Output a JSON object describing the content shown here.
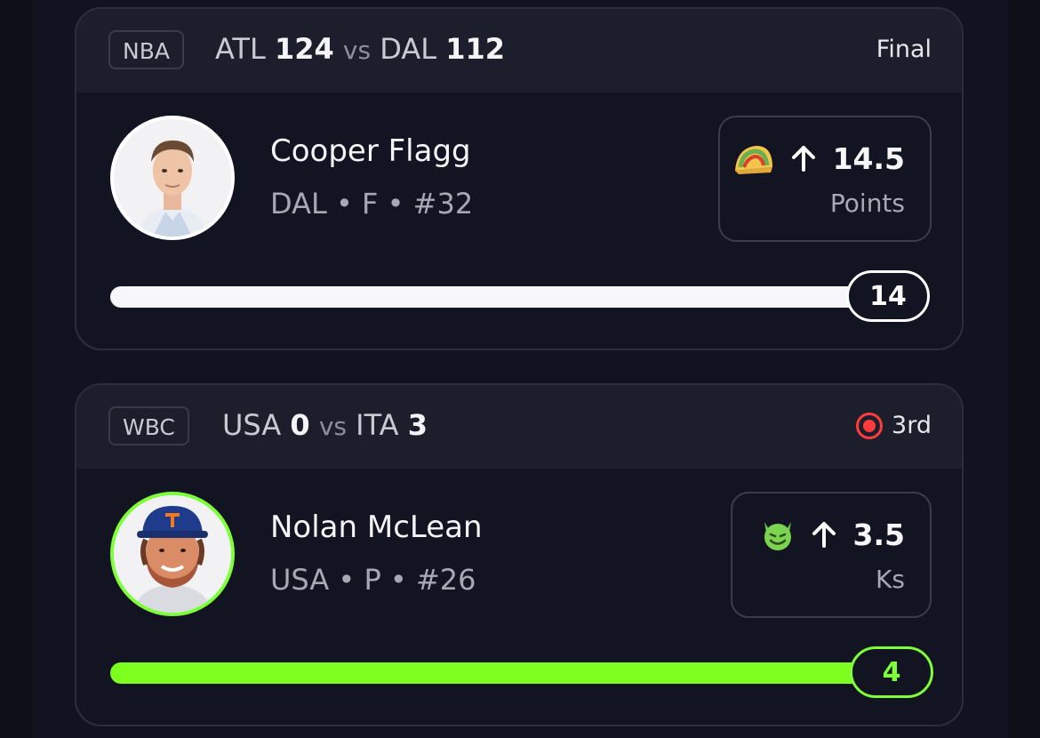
{
  "cards": [
    {
      "league": "NBA",
      "home_team": "ATL",
      "home_score": "124",
      "vs": "vs",
      "away_team": "DAL",
      "away_score": "112",
      "status": "Final",
      "player": {
        "name": "Cooper Flagg",
        "meta": "DAL • F • #32"
      },
      "pick": {
        "emoji_icon": "taco-icon",
        "direction_icon": "arrow-up-icon",
        "line": "14.5",
        "stat": "Points"
      },
      "progress": {
        "current": "14",
        "fill_fraction": 1.0,
        "color": "#f7f6fb"
      }
    },
    {
      "league": "WBC",
      "home_team": "USA",
      "home_score": "0",
      "vs": "vs",
      "away_team": "ITA",
      "away_score": "3",
      "status": "3rd",
      "live_indicator": "live-record-icon",
      "player": {
        "name": "Nolan McLean",
        "meta": "USA • P • #26"
      },
      "pick": {
        "emoji_icon": "smiling-devil-icon",
        "direction_icon": "arrow-up-icon",
        "line": "3.5",
        "stat": "Ks"
      },
      "progress": {
        "current": "4",
        "fill_fraction": 1.0,
        "color": "#7dff1f"
      }
    }
  ],
  "colors": {
    "background": "#0d0f16",
    "card": "#121521",
    "header": "#1c1f2b",
    "live_red": "#ff3b3b",
    "accent_green": "#7dff3a"
  }
}
